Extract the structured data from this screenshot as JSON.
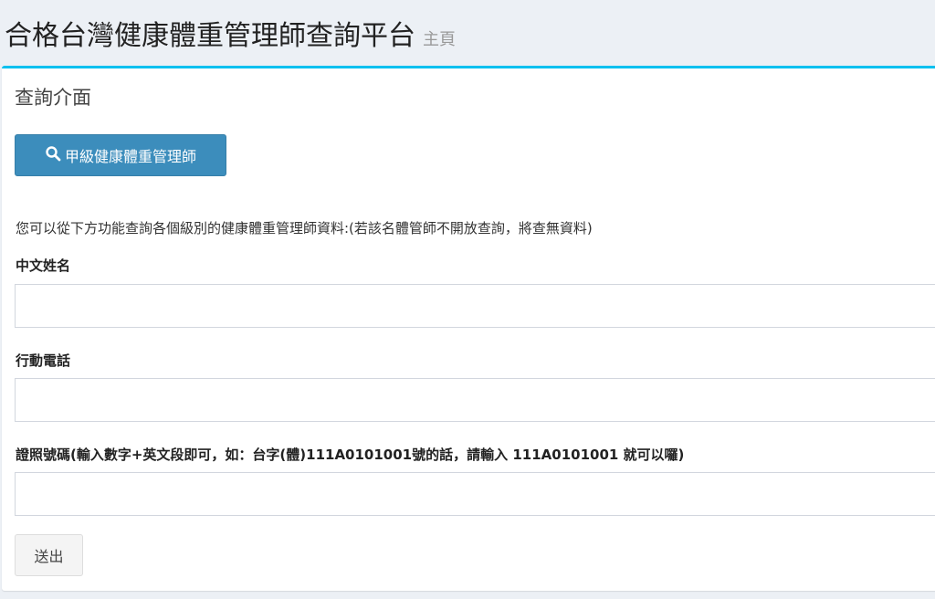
{
  "header": {
    "title": "合格台灣健康體重管理師查詢平台",
    "subtitle": "主頁"
  },
  "panel": {
    "title": "查詢介面",
    "category_button": {
      "icon": "search-icon",
      "label": "甲級健康體重管理師"
    },
    "intro": "您可以從下方功能查詢各個級別的健康體重管理師資料:(若該名體管師不開放查詢，將查無資料)"
  },
  "form": {
    "name_label": "中文姓名",
    "name_value": "",
    "phone_label": "行動電話",
    "phone_value": "",
    "cert_label": "證照號碼(輸入數字+英文段即可，如：台字(體)111A0101001號的話，請輸入 111A0101001 就可以囉)",
    "cert_value": "",
    "submit_label": "送出"
  },
  "colors": {
    "accent": "#00c0ef",
    "primary": "#3c8dbc",
    "background": "#ecf0f5"
  }
}
